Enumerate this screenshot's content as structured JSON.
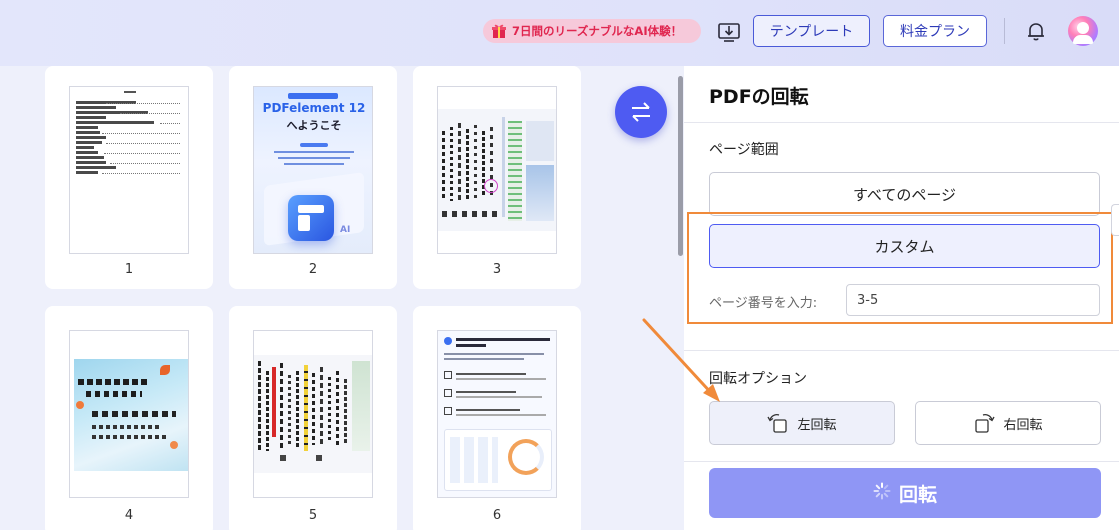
{
  "topbar": {
    "promo": "7日間のリーズナブルなAI体験！",
    "template_button": "テンプレート",
    "plan_button": "料金プラン"
  },
  "thumbnails": [
    {
      "num": "1"
    },
    {
      "num": "2",
      "title": "PDFelement 12",
      "subtitle": "へようこそ"
    },
    {
      "num": "3"
    },
    {
      "num": "4"
    },
    {
      "num": "5"
    },
    {
      "num": "6"
    }
  ],
  "panel": {
    "title": "PDFの回転",
    "range_label": "ページ範囲",
    "all_pages": "すべてのページ",
    "custom": "カスタム",
    "page_input_label": "ページ番号を入力:",
    "page_input_value": "3-5",
    "rotate_options_label": "回転オプション",
    "rotate_left": "左回転",
    "rotate_right": "右回転",
    "run_button": "回転"
  },
  "colors": {
    "accent": "#4e5bf2",
    "run_button": "#8f96f5",
    "highlight": "#f08a3a",
    "promo_text": "#e0264f"
  }
}
